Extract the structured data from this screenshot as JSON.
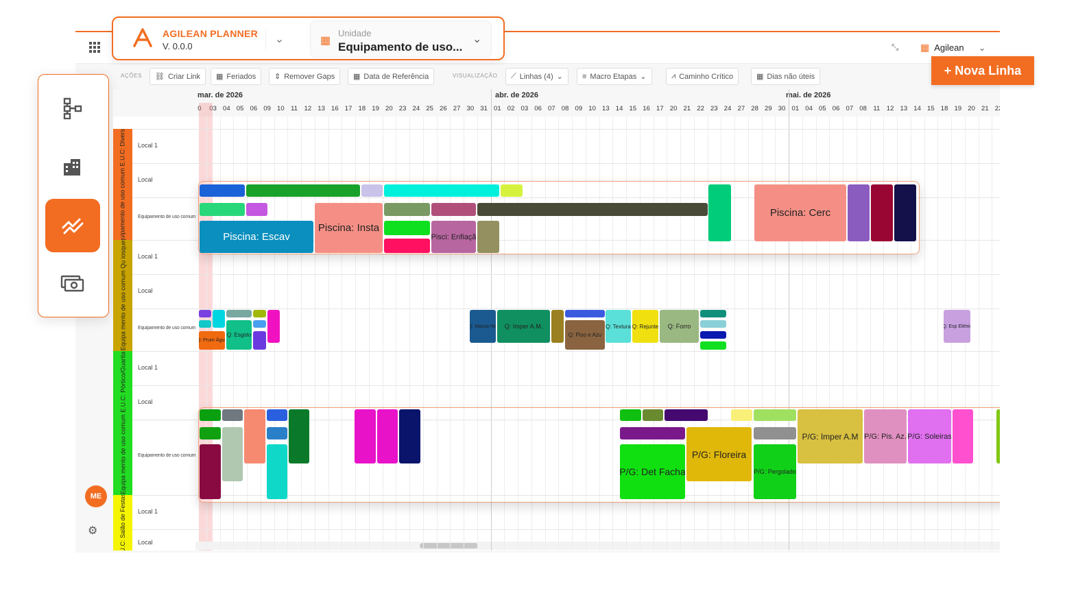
{
  "app": {
    "brand": "AGILEAN PLANNER",
    "version": "V. 0.0.0"
  },
  "unit": {
    "label": "Unidade",
    "value": "Equipamento de uso..."
  },
  "user": {
    "name": "Agilean",
    "initials": "ME"
  },
  "actions": {
    "section_label": "AÇÕES",
    "criar_link": "Criar Link",
    "feriados": "Feriados",
    "remover_gaps": "Remover Gaps",
    "data_referencia": "Data de Referência"
  },
  "view": {
    "section_label": "VISUALIZAÇÃO",
    "linhas": "Linhas (4)",
    "macro_etapas": "Macro Etapas",
    "caminho_critico": "Caminho Crítico",
    "dias_nao_uteis": "Dias não úteis"
  },
  "nova_linha": "+ Nova Linha",
  "colors": {
    "accent": "#f26d21"
  },
  "timeline": {
    "months": [
      "mar. de 2026",
      "abr. de 2026",
      "mai. de 2026"
    ],
    "days": [
      "0",
      "03",
      "04",
      "05",
      "06",
      "09",
      "10",
      "11",
      "12",
      "13",
      "16",
      "17",
      "18",
      "19",
      "20",
      "23",
      "24",
      "25",
      "26",
      "27",
      "30",
      "31",
      "01",
      "02",
      "03",
      "06",
      "07",
      "08",
      "09",
      "10",
      "13",
      "14",
      "15",
      "16",
      "17",
      "20",
      "21",
      "22",
      "23",
      "24",
      "27",
      "28",
      "29",
      "30",
      "01",
      "04",
      "05",
      "06",
      "07",
      "08",
      "11",
      "12",
      "13",
      "14",
      "15",
      "18",
      "19",
      "20",
      "21",
      "22"
    ]
  },
  "groups": [
    {
      "band": "Equipamento de uso comum E.U.C: Diversos",
      "color": "#f26d21"
    },
    {
      "band": "Equipa mento de uso comum Qu iosque",
      "color": "#c9a400"
    },
    {
      "band": "Equipa mento de uso comum E.U.C: Pórtico/Guarita",
      "color": "#22dd22"
    },
    {
      "band": "E.U.C: Salão de Festas",
      "color": "#f5f500"
    }
  ],
  "row_labels": {
    "local1": "Local 1",
    "local": "Local",
    "equip": "Equipamento de uso comum"
  },
  "tasks": {
    "piscina_escav": "Piscina: Escav",
    "piscina_insta": "Piscina: Insta",
    "pisci_enfiaca": "Pisci: Enfiaçã",
    "piscina_cerc": "Piscina: Cerc",
    "q_prum_agua": "Q: Prum Água",
    "q_esgoto": "Q: Esgoto",
    "q_massa_niv": "Q: Massa Niv",
    "q_imper_am": "Q: Imper A.M.",
    "q_piso_azu": "Q: Piso e Azu",
    "q_textura": "Q: Textura",
    "q_rejunte": "Q: Rejunte",
    "q_forro": "Q: Forro",
    "q_esp_eletric": "Q: Esp Elétric",
    "pg_det_facha": "P/G: Det Facha",
    "pg_floreira": "P/G: Floreira",
    "pg_pergolado": "P/G: Pergolado",
    "pg_imper_am": "P/G: Imper A.M",
    "pg_pis_az": "P/G: Pis. Az.",
    "pg_soleiras": "P/G: Soleiras"
  }
}
